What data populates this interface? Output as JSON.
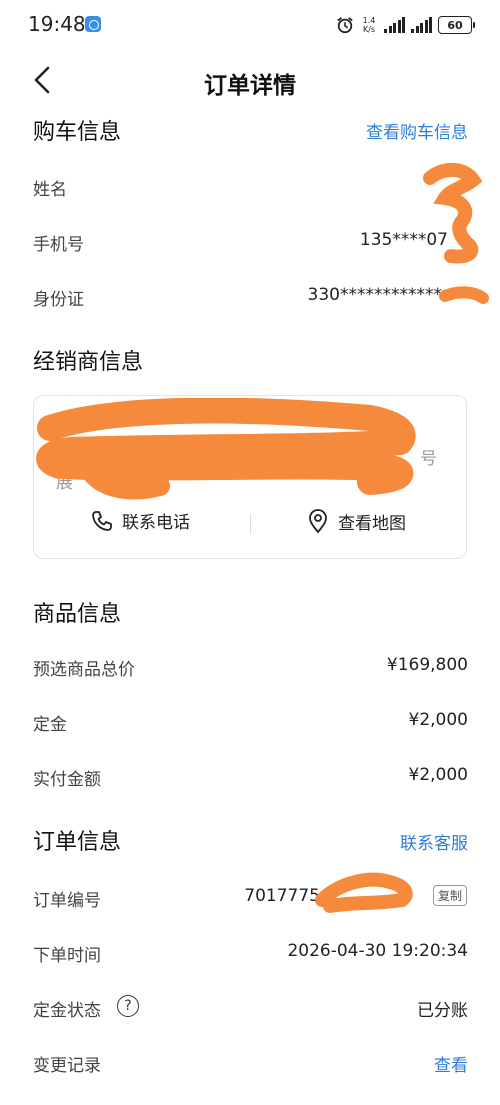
{
  "status_bar": {
    "time": "19:48",
    "net_speed_value": "1.4",
    "net_speed_unit": "K/s",
    "battery": "60"
  },
  "nav": {
    "title": "订单详情"
  },
  "buyer_section": {
    "title": "购车信息",
    "link": "查看购车信息",
    "rows": [
      {
        "label": "姓名",
        "value": ""
      },
      {
        "label": "手机号",
        "value": "135****07"
      },
      {
        "label": "身份证",
        "value": "330************"
      }
    ]
  },
  "dealer_section": {
    "title": "经销商信息",
    "address_tail": "号",
    "address_partial": "展",
    "call_label": "联系电话",
    "map_label": "查看地图"
  },
  "product_section": {
    "title": "商品信息",
    "rows": [
      {
        "label": "预选商品总价",
        "value": "¥169,800"
      },
      {
        "label": "定金",
        "value": "¥2,000"
      },
      {
        "label": "实付金额",
        "value": "¥2,000"
      }
    ]
  },
  "order_section": {
    "title": "订单信息",
    "link": "联系客服",
    "order_no_label": "订单编号",
    "order_no_value": "7017775",
    "copy_label": "复制",
    "time_label": "下单时间",
    "time_value": "2026-04-30 19:20:34",
    "deposit_label": "定金状态",
    "help_glyph": "?",
    "deposit_value": "已分账",
    "change_label": "变更记录",
    "change_link": "查看"
  },
  "colors": {
    "accent": "#2d7ed6",
    "redaction": "#f58a3c"
  }
}
